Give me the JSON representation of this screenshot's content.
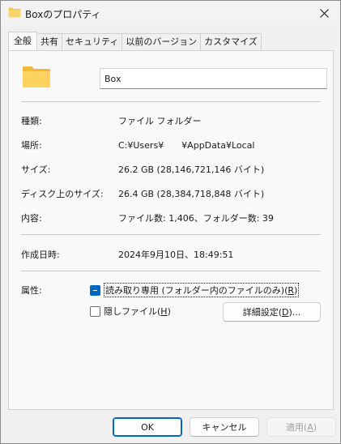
{
  "window": {
    "title": "Boxのプロパティ",
    "close_glyph": "✕"
  },
  "tabs": [
    {
      "label": "全般",
      "active": true
    },
    {
      "label": "共有",
      "active": false
    },
    {
      "label": "セキュリティ",
      "active": false
    },
    {
      "label": "以前のバージョン",
      "active": false
    },
    {
      "label": "カスタマイズ",
      "active": false
    }
  ],
  "general": {
    "folder_name": "Box",
    "type_label": "種類:",
    "type_value": "ファイル フォルダー",
    "location_label": "場所:",
    "location_value": "C:¥Users¥　　¥AppData¥Local",
    "size_label": "サイズ:",
    "size_value": "26.2 GB (28,146,721,146 バイト)",
    "disk_size_label": "ディスク上のサイズ:",
    "disk_size_value": "26.4 GB (28,384,718,848 バイト)",
    "contents_label": "内容:",
    "contents_value": "ファイル数: 1,406、フォルダー数: 39",
    "created_label": "作成日時:",
    "created_value": "2024年9月10日、18:49:51",
    "attributes_label": "属性:",
    "readonly_label": "読み取り専用 (フォルダー内のファイルのみ)(",
    "readonly_key": "R",
    "readonly_tail": ")",
    "readonly_state": "indeterminate",
    "hidden_label": "隠しファイル(",
    "hidden_key": "H",
    "hidden_tail": ")",
    "hidden_state": "unchecked",
    "advanced_label": "詳細設定(",
    "advanced_key": "D",
    "advanced_tail": ")..."
  },
  "buttons": {
    "ok": "OK",
    "cancel": "キャンセル",
    "apply_label": "適用(",
    "apply_key": "A",
    "apply_tail": ")"
  },
  "colors": {
    "accent": "#0067c0",
    "folder": "#f8c74a"
  }
}
